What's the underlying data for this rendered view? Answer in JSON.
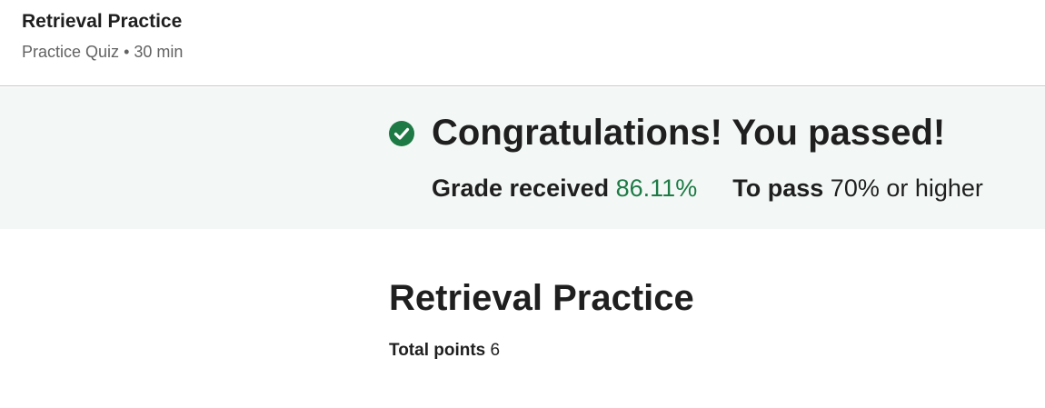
{
  "header": {
    "title": "Retrieval Practice",
    "type": "Practice Quiz",
    "separator": "•",
    "duration": "30 min"
  },
  "result": {
    "message": "Congratulations! You passed!",
    "grade_label": "Grade received",
    "grade_value": "86.11%",
    "pass_label": "To pass",
    "pass_value": "70% or higher",
    "icon": "check-circle-icon",
    "accent_color": "#1d7a45"
  },
  "assignment": {
    "title": "Retrieval Practice",
    "points_label": "Total points",
    "points_value": "6"
  }
}
